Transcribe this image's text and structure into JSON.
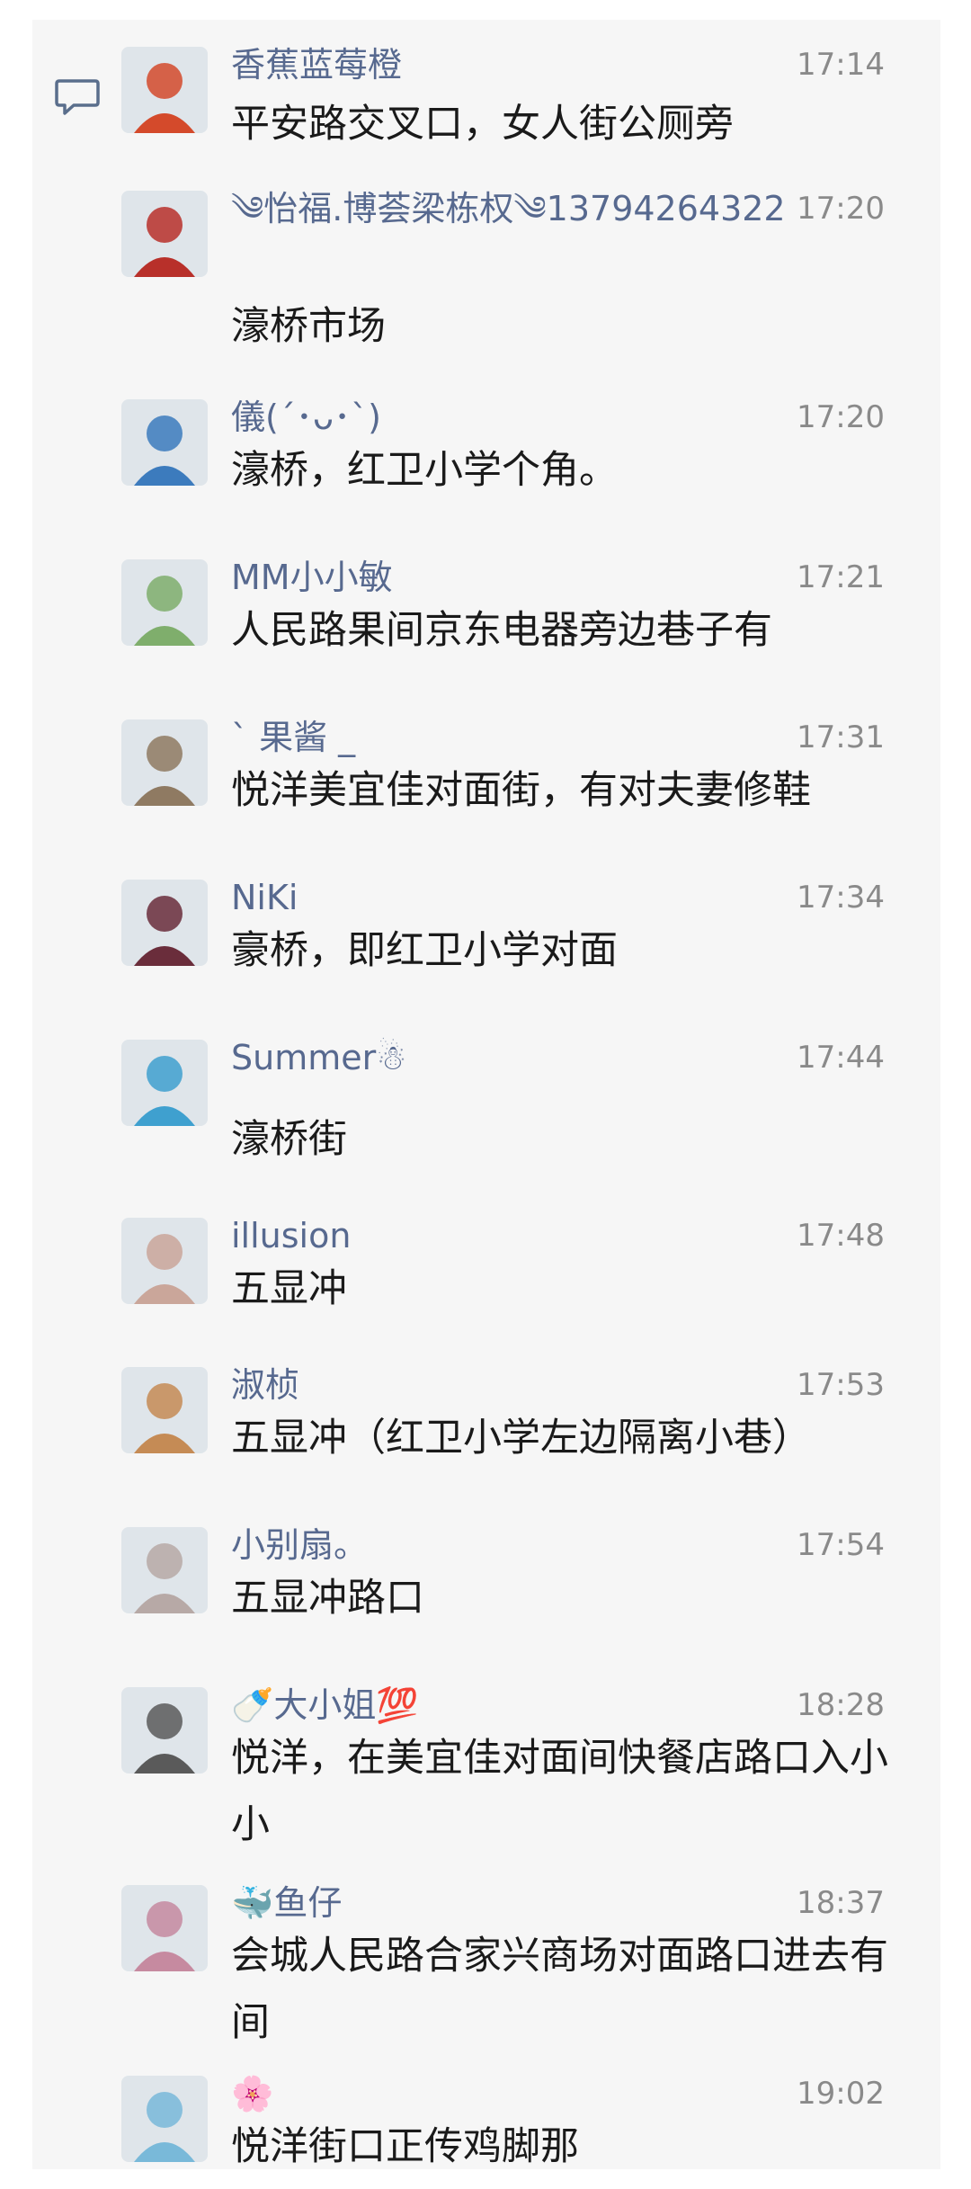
{
  "messages": [
    {
      "name": "香蕉蓝莓橙",
      "time": "17:14",
      "text": "平安路交叉口，女人街公厕旁",
      "avatar": "hot-air-balloon-avatar",
      "color": "#d44a2b"
    },
    {
      "name": "༄怡福.博荟梁栋权༄13794264322",
      "time": "17:20",
      "text": "濠桥市场",
      "avatar": "man-in-suit-avatar",
      "color": "#b8302a"
    },
    {
      "name": "儀(´･ᴗ･`)",
      "time": "17:20",
      "text": "濠桥，红卫小学个角。",
      "avatar": "cartoon-crocodile-avatar",
      "color": "#3c7bbd"
    },
    {
      "name": "MM小小敏",
      "time": "17:21",
      "text": "人民路果间京东电器旁边巷子有",
      "avatar": "woman-flowers-avatar",
      "color": "#7fae6c"
    },
    {
      "name": "` 果酱 _",
      "time": "17:31",
      "text": "悦洋美宜佳对面街，有对夫妻修鞋",
      "avatar": "anime-girl-avatar",
      "color": "#8f7a62"
    },
    {
      "name": "NiKi",
      "time": "17:34",
      "text": "豪桥，即红卫小学对面",
      "avatar": "dark-portrait-avatar",
      "color": "#6a2d3b"
    },
    {
      "name": "Summer☃",
      "time": "17:44",
      "text": "濠桥街",
      "avatar": "green-heart-avatar",
      "color": "#3fa0cf"
    },
    {
      "name": "illusion",
      "time": "17:48",
      "text": "五显冲",
      "avatar": "young-woman-avatar",
      "color": "#caa69a"
    },
    {
      "name": "淑桢",
      "time": "17:53",
      "text": "五显冲（红卫小学左边隔离小巷）",
      "avatar": "child-face-avatar",
      "color": "#c58b55"
    },
    {
      "name": "小别扇。",
      "time": "17:54",
      "text": "五显冲路口",
      "avatar": "couple-photo-avatar",
      "color": "#b7a9a6"
    },
    {
      "name": "🍼大小姐💯",
      "time": "18:28",
      "text": "悦洋，在美宜佳对面间快餐店路口入小小",
      "avatar": "woman-sunglasses-avatar",
      "color": "#5a5a5a"
    },
    {
      "name": "🐳鱼仔",
      "time": "18:37",
      "text": "会城人民路合家兴商场对面路口进去有间",
      "avatar": "girl-glasses-avatar",
      "color": "#c68aa0"
    },
    {
      "name": "🌸",
      "time": "19:02",
      "text": "悦洋街口正传鸡脚那",
      "avatar": "cartoon-cat-avatar",
      "color": "#79b9d9"
    }
  ]
}
